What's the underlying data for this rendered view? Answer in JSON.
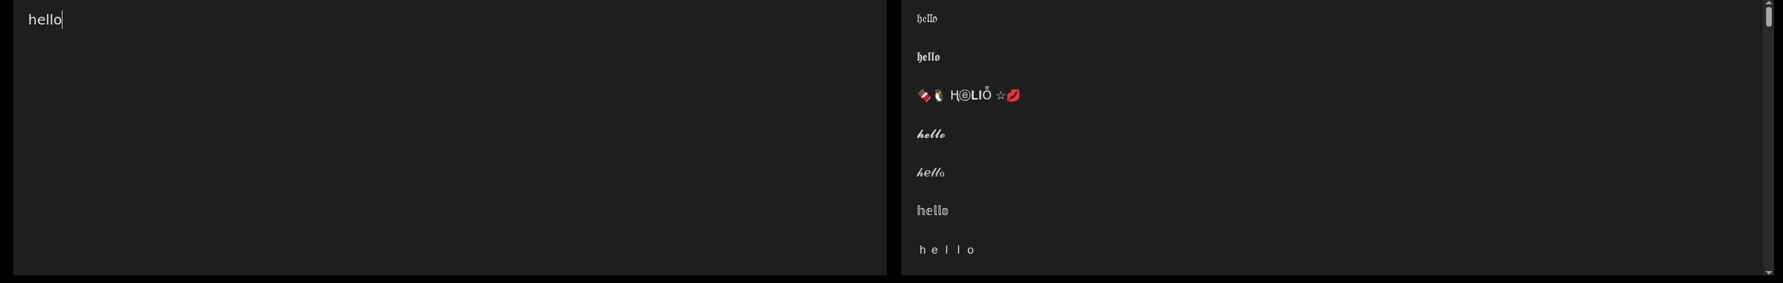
{
  "editor": {
    "value": "hello"
  },
  "results": [
    "𝔥𝔢𝔩𝔩𝔬",
    "𝖍𝖊𝖑𝖑𝖔",
    "🍫🐧  Ⱨⓔ𝐋𝐥Ỗ  ☆💋",
    "𝓱𝓮𝓵𝓵𝓸",
    "𝒽ℯ𝓁𝓁ℴ",
    "𝕙𝕖𝕝𝕝𝕠",
    "ｈｅｌｌｏ"
  ]
}
